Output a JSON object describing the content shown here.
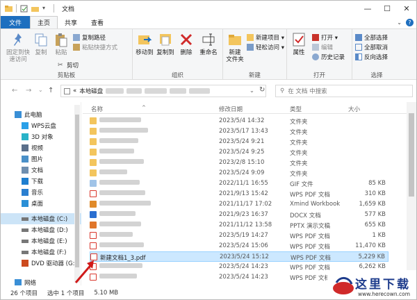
{
  "window": {
    "title": "文档"
  },
  "window_controls": {
    "minimize": "—",
    "maximize": "☐",
    "close": "✕"
  },
  "tabs": [
    "文件",
    "主页",
    "共享",
    "查看"
  ],
  "ribbon": {
    "clipboard": {
      "pin": "固定到快\n速访问",
      "copy": "复制",
      "paste": "粘贴",
      "copy_path": "复制路径",
      "paste_shortcut": "粘贴快捷方式",
      "cut": "剪切",
      "label": "剪贴板"
    },
    "organize": {
      "move_to": "移动到",
      "copy_to": "复制到",
      "delete": "删除",
      "rename": "重命名",
      "label": "组织"
    },
    "new": {
      "new_folder": "新建\n文件夹",
      "new_item": "新建项目 ▾",
      "easy_access": "轻松访问 ▾",
      "label": "新建"
    },
    "open": {
      "properties": "属性",
      "open": "打开 ▾",
      "edit": "编辑",
      "history": "历史记录",
      "label": "打开"
    },
    "select": {
      "select_all": "全部选择",
      "select_none": "全部取消",
      "invert": "反向选择",
      "label": "选择"
    }
  },
  "address": {
    "path_prefix": "«",
    "drive": "本地磁盘",
    "search_placeholder": "在 文档 中搜索"
  },
  "nav": [
    {
      "label": "此电脑",
      "icon": "computer-icon",
      "color": "#3a8fd6"
    },
    {
      "label": "WPS云盘",
      "icon": "cloud-icon",
      "color": "#2aa0e8"
    },
    {
      "label": "3D 对象",
      "icon": "cube-icon",
      "color": "#29b3c8"
    },
    {
      "label": "视频",
      "icon": "video-icon",
      "color": "#5a6f8a"
    },
    {
      "label": "图片",
      "icon": "picture-icon",
      "color": "#4a90c8"
    },
    {
      "label": "文档",
      "icon": "document-icon",
      "color": "#6f8fb0"
    },
    {
      "label": "下载",
      "icon": "download-icon",
      "color": "#1e7fd0"
    },
    {
      "label": "音乐",
      "icon": "music-icon",
      "color": "#2a7fd0"
    },
    {
      "label": "桌面",
      "icon": "desktop-icon",
      "color": "#2a8fd6"
    },
    {
      "label": "本地磁盘 (C:)",
      "icon": "drive-icon",
      "color": "#777"
    },
    {
      "label": "本地磁盘 (D:)",
      "icon": "drive-icon",
      "color": "#777"
    },
    {
      "label": "本地磁盘 (E:)",
      "icon": "drive-icon",
      "color": "#777"
    },
    {
      "label": "本地磁盘 (F:)",
      "icon": "drive-icon",
      "color": "#777"
    },
    {
      "label": "DVD 驱动器 (G:",
      "icon": "dvd-icon",
      "color": "#cc4a1e"
    },
    {
      "label": "网络",
      "icon": "network-icon",
      "color": "#3a8fd6"
    }
  ],
  "columns": {
    "name": "名称",
    "date": "修改日期",
    "type": "类型",
    "size": "大小"
  },
  "files": [
    {
      "name": "",
      "date": "2023/5/4 14:32",
      "type": "文件夹",
      "size": "",
      "icon": "folder",
      "blurw": 60
    },
    {
      "name": "",
      "date": "2023/5/17 13:43",
      "type": "文件夹",
      "size": "",
      "icon": "folder",
      "blurw": 70
    },
    {
      "name": "",
      "date": "2023/5/24 9:21",
      "type": "文件夹",
      "size": "",
      "icon": "folder",
      "blurw": 56
    },
    {
      "name": "",
      "date": "2023/5/24 9:25",
      "type": "文件夹",
      "size": "",
      "icon": "folder",
      "blurw": 50
    },
    {
      "name": "",
      "date": "2023/2/8 15:10",
      "type": "文件夹",
      "size": "",
      "icon": "folder",
      "blurw": 64
    },
    {
      "name": "",
      "date": "2023/5/24 9:09",
      "type": "文件夹",
      "size": "",
      "icon": "folder",
      "blurw": 40
    },
    {
      "name": "",
      "date": "2022/11/1 16:55",
      "type": "GIF 文件",
      "size": "85 KB",
      "icon": "gif",
      "blurw": 58
    },
    {
      "name": "",
      "date": "2021/9/13 15:42",
      "type": "WPS PDF 文档",
      "size": "310 KB",
      "icon": "pdf",
      "blurw": 66
    },
    {
      "name": "",
      "date": "2021/11/17 17:02",
      "type": "Xmind Workbook",
      "size": "1,659 KB",
      "icon": "xmind",
      "blurw": 74
    },
    {
      "name": "",
      "date": "2021/9/23 16:37",
      "type": "DOCX 文档",
      "size": "577 KB",
      "icon": "docx",
      "blurw": 52
    },
    {
      "name": "",
      "date": "2021/11/12 13:58",
      "type": "PPTX 演示文稿",
      "size": "655 KB",
      "icon": "pptx",
      "blurw": 60
    },
    {
      "name": "",
      "date": "2023/5/19 14:27",
      "type": "WPS PDF 文档",
      "size": "1 KB",
      "icon": "pdf",
      "blurw": 48
    },
    {
      "name": "",
      "date": "2023/5/24 15:06",
      "type": "WPS PDF 文档",
      "size": "11,470 KB",
      "icon": "pdf",
      "blurw": 64
    },
    {
      "name": "新建文档1_3.pdf",
      "date": "2023/5/24 15:12",
      "type": "WPS PDF 文档",
      "size": "5,229 KB",
      "icon": "pdf",
      "blurw": 0,
      "selected": true
    },
    {
      "name": "",
      "date": "2023/5/24 14:23",
      "type": "WPS PDF 文档",
      "size": "6,262 KB",
      "icon": "pdf",
      "blurw": 62
    },
    {
      "name": "",
      "date": "2023/5/24 14:23",
      "type": "WPS PDF 文档",
      "size": "8,816 KB",
      "icon": "pdf",
      "blurw": 54
    }
  ],
  "status": {
    "count": "26 个项目",
    "selected": "选中 1 个项目",
    "size": "5.10 MB"
  },
  "watermark": {
    "text": "这里下载",
    "url": "www.herecown.com"
  },
  "colors": {
    "accent": "#1e6fbf",
    "selection": "#cce8ff",
    "pdf": "#d9362b",
    "folder": "#f3c55d"
  }
}
